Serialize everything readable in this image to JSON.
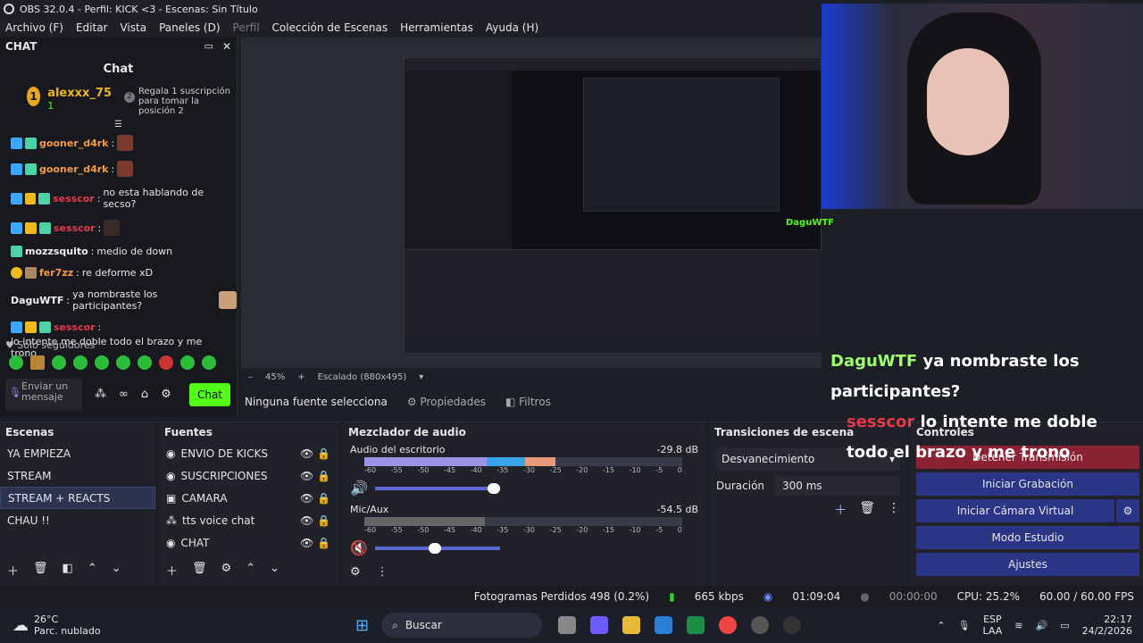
{
  "window": {
    "title": "OBS 32.0.4 - Perfil: KICK <3 - Escenas: Sin Título"
  },
  "menu": [
    "Archivo (F)",
    "Editar",
    "Vista",
    "Paneles (D)",
    "Perfil",
    "Colección de Escenas",
    "Herramientas",
    "Ayuda (H)"
  ],
  "chatdock": {
    "header": "CHAT",
    "title": "Chat",
    "gift": {
      "rank": "1",
      "user": "alexxx_75",
      "count": "1",
      "text": "Regala 1 suscripción para tomar la posición 2",
      "pos": "2"
    },
    "messages": [
      {
        "user": "gooner_d4rk",
        "sep": ":",
        "text": ""
      },
      {
        "user": "gooner_d4rk",
        "sep": ":",
        "text": ""
      },
      {
        "user": "sesscor",
        "sep": ":",
        "text": "no esta hablando de secso?"
      },
      {
        "user": "sesscor",
        "sep": ":",
        "text": ""
      },
      {
        "user": "mozzsquito",
        "sep": ":",
        "text": "medio de down"
      },
      {
        "user": "fer7zz",
        "sep": ":",
        "text": "re deforme xD"
      },
      {
        "user": "DaguWTF",
        "sep": ":",
        "text": "ya nombraste los participantes?"
      },
      {
        "user": "sesscor",
        "sep": ":",
        "text": "lo intente me doble todo el brazo y me trono"
      }
    ],
    "followers_only": "Solo seguidores",
    "input_placeholder": "Enviar un mensaje",
    "send_label": "Chat"
  },
  "preview": {
    "zoom": "45%",
    "scale": "Escalado (880x495)"
  },
  "context_bar": {
    "no_source": "Ninguna fuente selecciona",
    "properties": "Propiedades",
    "filters": "Filtros"
  },
  "overlay": {
    "dagu_user": "DaguWTF",
    "dagu_msg": "ya nombraste los participantes?",
    "sess_user": "sesscor",
    "sess_msg": "lo intente me doble todo el brazo y me trono"
  },
  "scenes": {
    "title": "Escenas",
    "items": [
      "YA EMPIEZA",
      "STREAM",
      "STREAM + REACTS",
      "CHAU !!"
    ],
    "selected": 2
  },
  "sources": {
    "title": "Fuentes",
    "items": [
      "ENVIO DE KICKS",
      "SUSCRIPCIONES",
      "CAMARA",
      "tts voice chat",
      "CHAT"
    ]
  },
  "mixer": {
    "title": "Mezclador de audio",
    "tracks": [
      {
        "name": "Audio del escritorio",
        "db": "-29.8 dB",
        "level": 0.6
      },
      {
        "name": "Mic/Aux",
        "db": "-54.5 dB",
        "level": 0.38
      }
    ],
    "ticks": [
      "-60",
      "-55",
      "-50",
      "-45",
      "-40",
      "-35",
      "-30",
      "-25",
      "-20",
      "-15",
      "-10",
      "-5",
      "0"
    ]
  },
  "transitions": {
    "title": "Transiciones de escena",
    "selected": "Desvanecimiento",
    "duration_label": "Duración",
    "duration": "300 ms"
  },
  "controls": {
    "title": "Controles",
    "buttons": [
      "Detener Transmisión",
      "Iniciar Grabación",
      "Iniciar Cámara Virtual",
      "Modo Estudio",
      "Ajustes"
    ]
  },
  "status": {
    "frames": "Fotogramas Perdidos 498 (0.2%)",
    "kbps": "665 kbps",
    "stream_time": "01:09:04",
    "rec_time": "00:00:00",
    "cpu": "CPU: 25.2%",
    "fps": "60.00 / 60.00 FPS"
  },
  "taskbar": {
    "temp": "26°C",
    "weather": "Parc. nublado",
    "search": "Buscar",
    "lang1": "ESP",
    "lang2": "LAA",
    "time": "22:17",
    "date": "24/2/2026"
  }
}
